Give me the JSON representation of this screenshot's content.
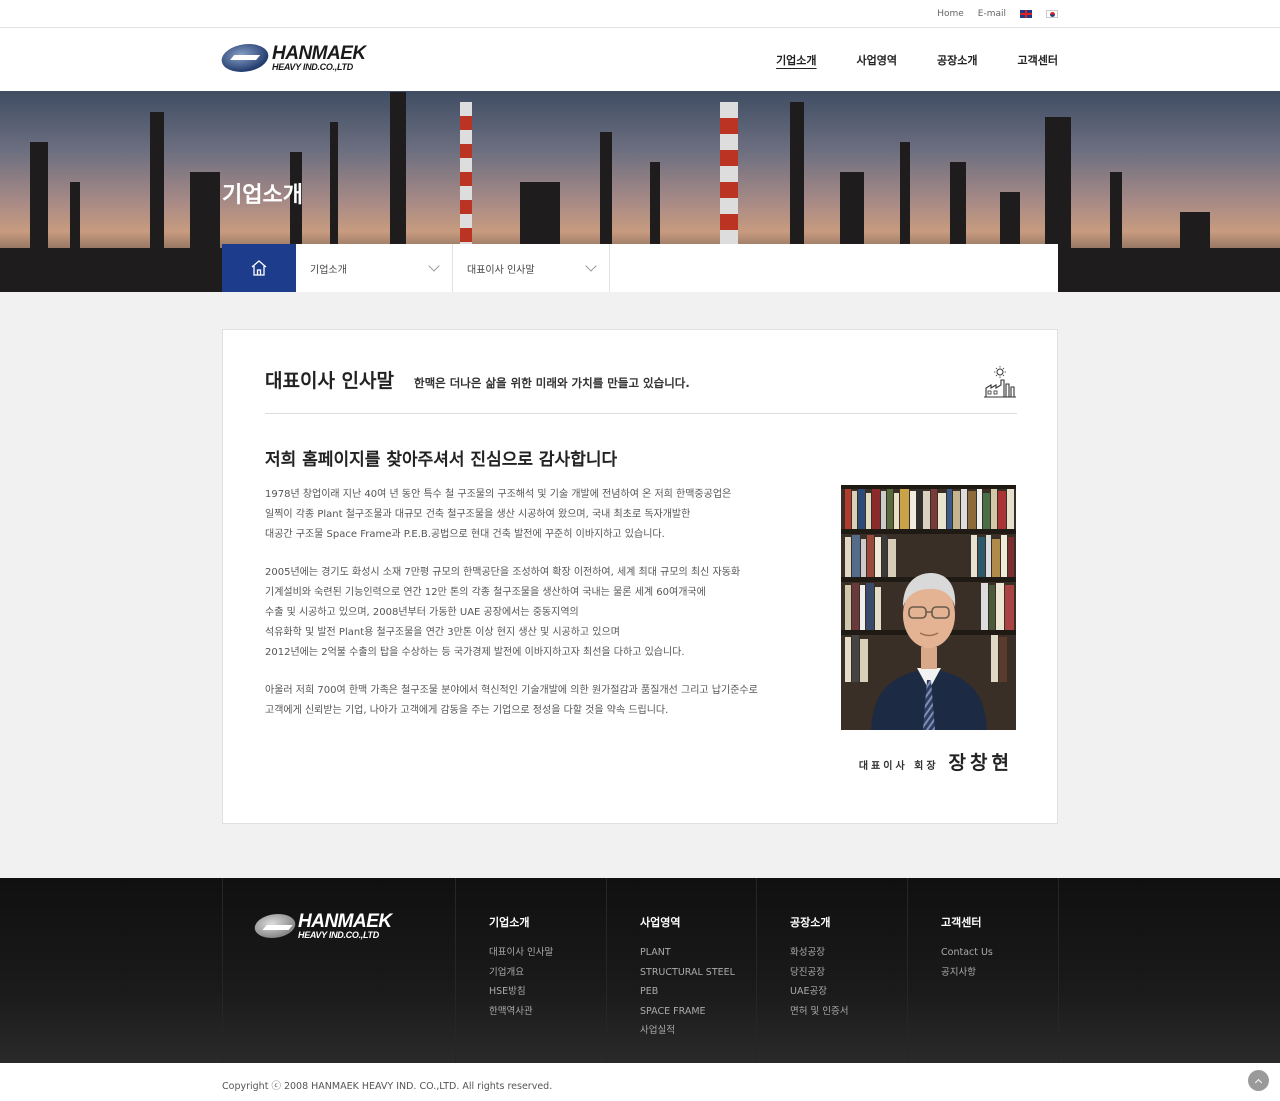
{
  "util": {
    "home": "Home",
    "email": "E-mail"
  },
  "logo": {
    "line1": "HANMAEK",
    "line2": "HEAVY IND.CO.,LTD"
  },
  "nav": [
    "기업소개",
    "사업영역",
    "공장소개",
    "고객센터"
  ],
  "hero": {
    "title": "기업소개"
  },
  "breadcrumb": {
    "level1": "기업소개",
    "level2": "대표이사 인사말"
  },
  "section": {
    "title": "대표이사 인사말",
    "subtitle": "한맥은 더나은 삶을 위한 미래와 가치를 만들고 있습니다.",
    "greeting": "저희 홈페이지를 찾아주셔서 진심으로 감사합니다",
    "p1": [
      "1978년 창업이래 지난 40여 년 동안 특수 철 구조물의 구조해석 및 기술 개발에 전념하여 온 저희 한맥중공업은",
      "일찍이 각종 Plant 철구조물과 대규모 건축 철구조물을 생산 시공하여 왔으며, 국내 최초로 독자개발한",
      "대공간 구조물 Space Frame과 P.E.B.공법으로 현대 건축 발전에 꾸준히 이바지하고 있습니다."
    ],
    "p2": [
      "2005년에는 경기도 화성시 소재 7만평 규모의 한맥공단을 조성하여 확장 이전하여, 세계 최대 규모의 최신 자동화",
      "기계설비와 숙련된 기능인력으로 연간 12만 톤의 각종 철구조물을 생산하여 국내는 물론 세계 60여개국에",
      "수출 및 시공하고 있으며, 2008년부터 가동한 UAE 공장에서는 중동지역의",
      "석유화학 및 발전 Plant용 철구조물을 연간 3만톤 이상 현지 생산 및 시공하고 있으며",
      "2012년에는 2억불 수출의 탑을 수상하는 등 국가경제 발전에 이바지하고자 최선을 다하고 있습니다."
    ],
    "p3": [
      "아울러 저희 700여 한맥 가족은 철구조물 분야에서 혁신적인 기술개발에 의한 원가절감과 품질개선 그리고 납기준수로",
      "고객에게 신뢰받는 기업, 나아가 고객에게 감동을 주는 기업으로 정성을 다할 것을 약속 드립니다."
    ],
    "signature_role": "대표이사 회장",
    "signature_name": "장창현"
  },
  "footer": {
    "logo": {
      "line1": "HANMAEK",
      "line2": "HEAVY IND.CO.,LTD"
    },
    "columns": [
      {
        "title": "기업소개",
        "links": [
          "대표이사 인사말",
          "기업개요",
          "HSE방침",
          "한맥역사관"
        ]
      },
      {
        "title": "사업영역",
        "links": [
          "PLANT",
          "STRUCTURAL STEEL",
          "PEB",
          "SPACE FRAME",
          "사업실적"
        ]
      },
      {
        "title": "공장소개",
        "links": [
          "화성공장",
          "당진공장",
          "UAE공장",
          "면허 및 인증서"
        ]
      },
      {
        "title": "고객센터",
        "links": [
          "Contact Us",
          "공지사항"
        ]
      }
    ],
    "copyright": "Copyright ⓒ 2008 HANMAEK HEAVY IND. CO.,LTD. All rights reserved."
  },
  "icons": {
    "home": "home-icon",
    "section": "factory-icon",
    "top": "arrow-up-icon"
  }
}
